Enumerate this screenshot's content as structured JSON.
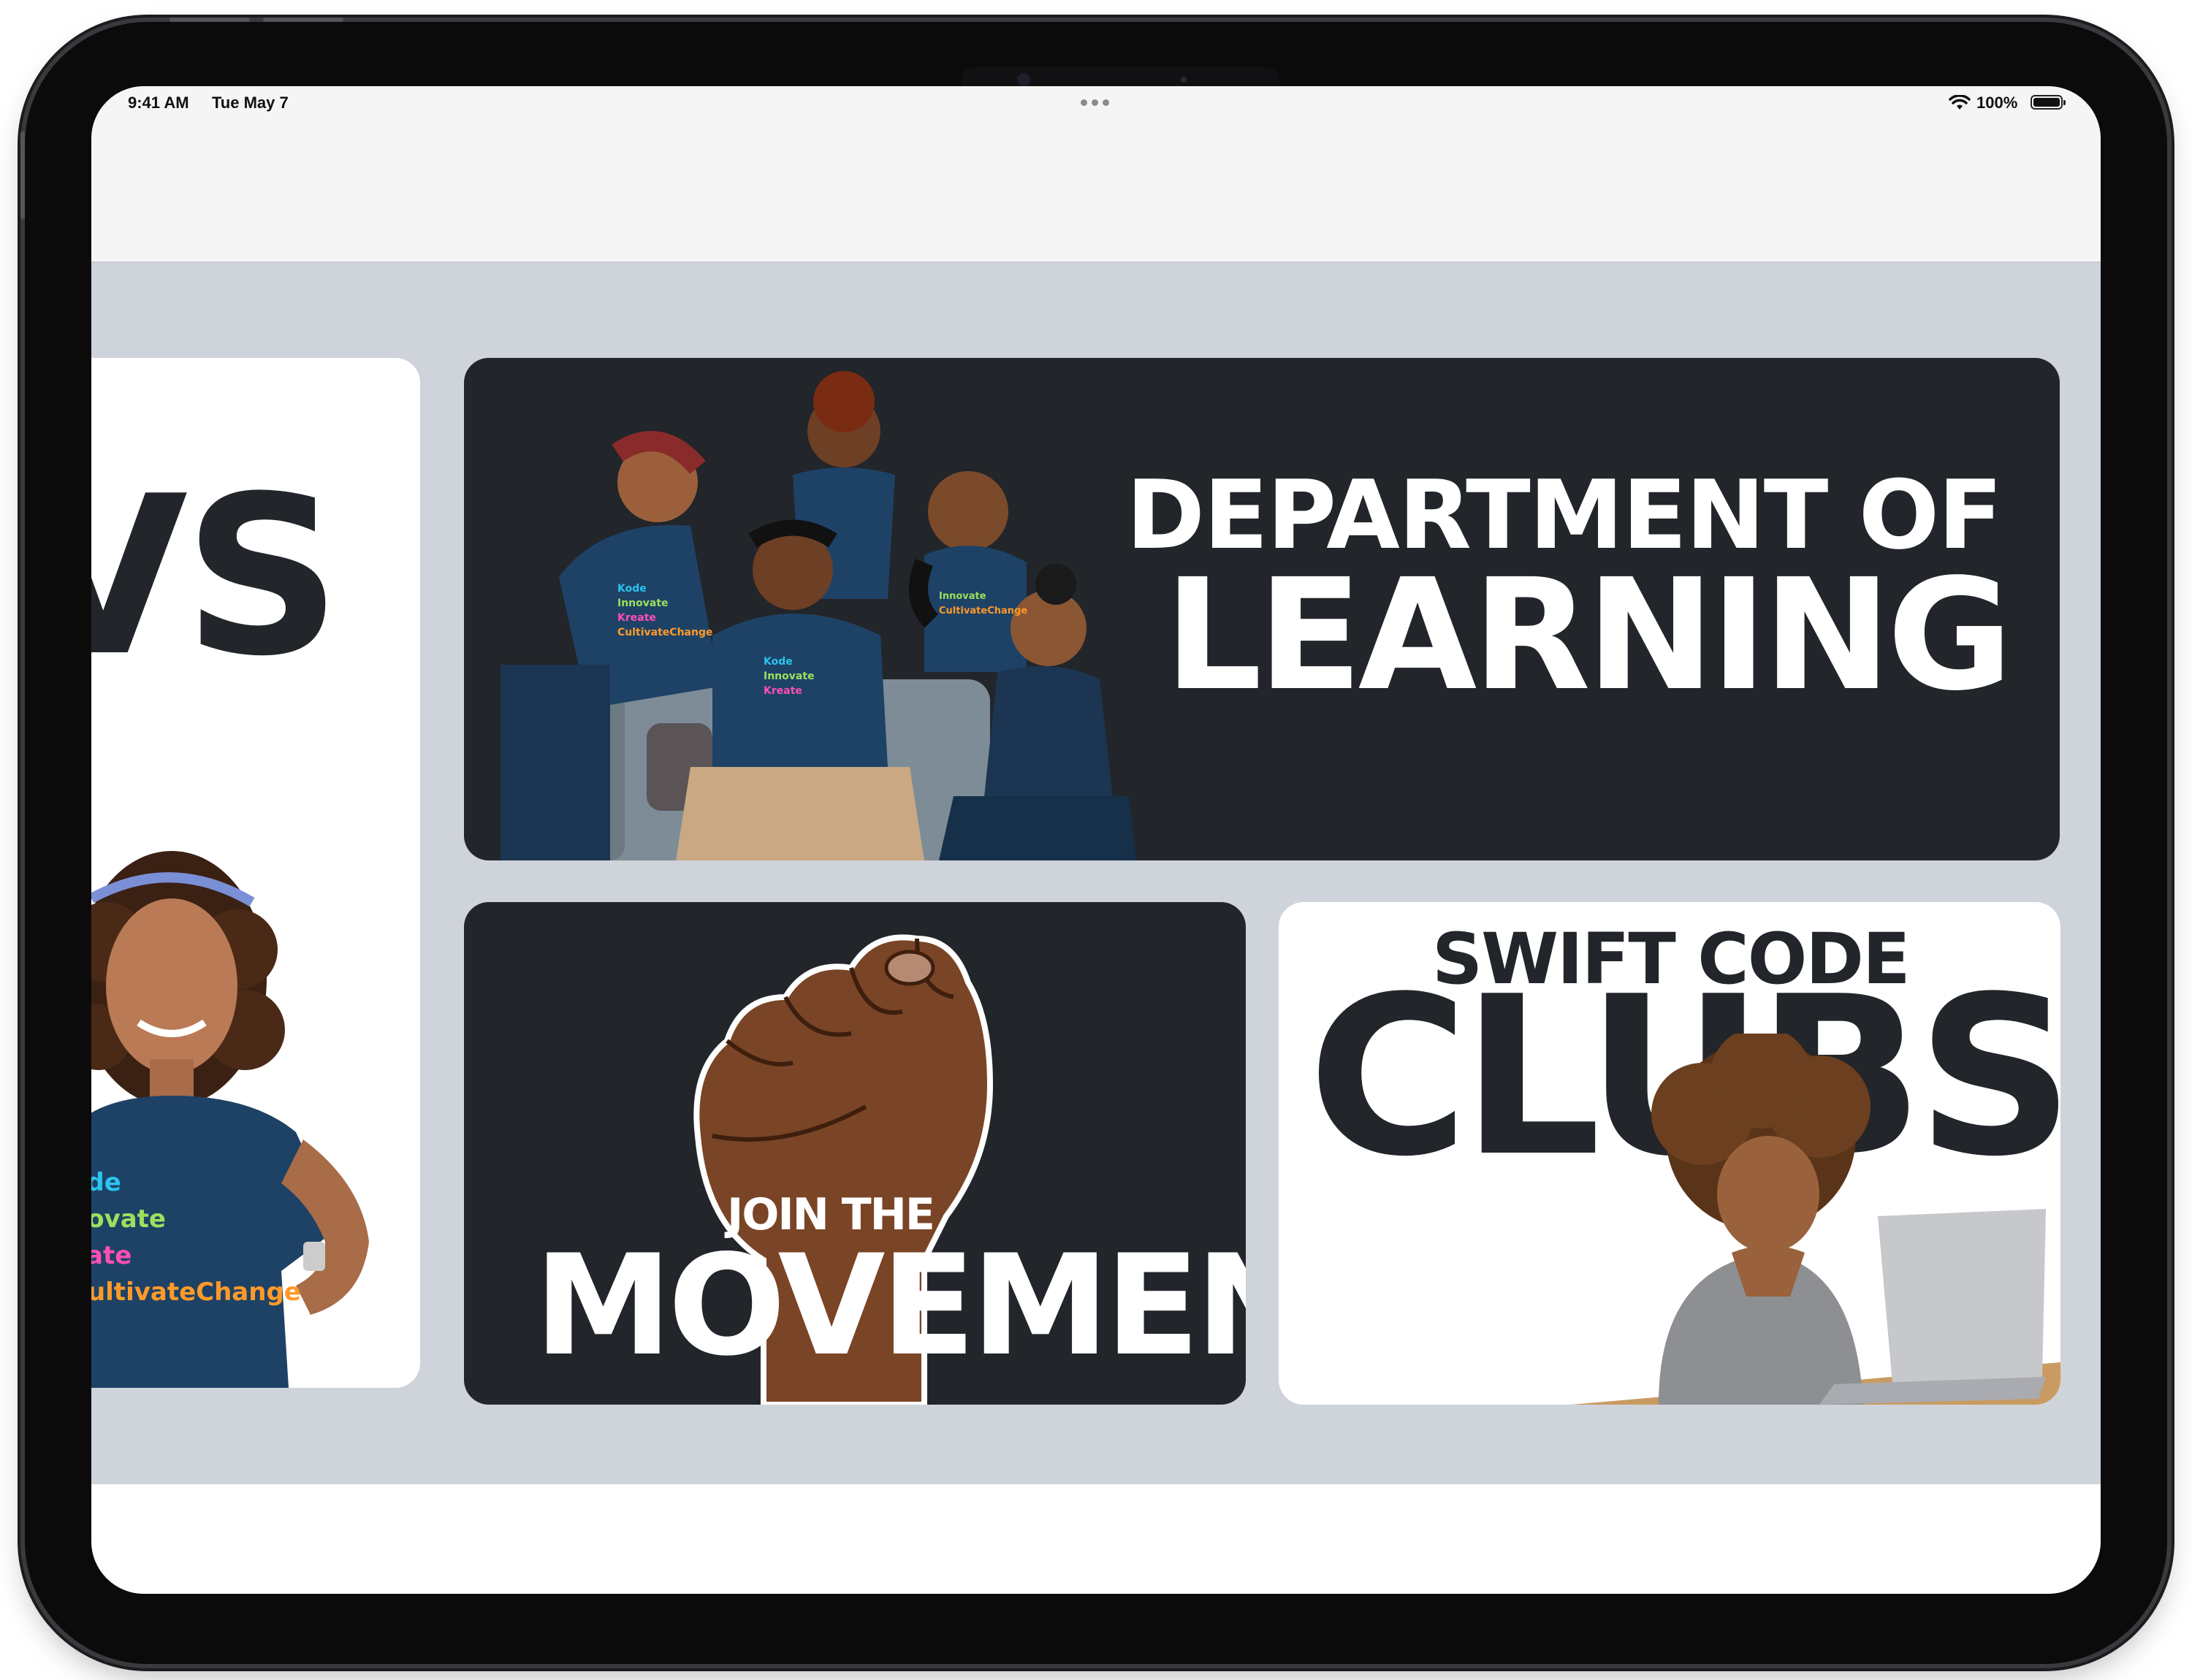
{
  "status_bar": {
    "time": "9:41 AM",
    "date": "Tue May 7",
    "battery_percent": "100%",
    "battery_level": 1.0,
    "icons": [
      "wifi-icon",
      "battery-icon",
      "more-dots-icon"
    ]
  },
  "cards": {
    "news": {
      "partial_title": "VS",
      "photo": "woman-portrait"
    },
    "department": {
      "line1": "DEPARTMENT OF",
      "line2": "LEARNING",
      "photo": "team-group-photo"
    },
    "movement": {
      "line1": "JOIN THE",
      "line2": "MOVEMENT",
      "graphic": "raised-fist-icon"
    },
    "swift": {
      "line1": "SWIFT CODE",
      "line2": "CLUBS",
      "photo": "child-with-laptop"
    }
  },
  "colors": {
    "card_dark": "#22252a",
    "card_light": "#ffffff",
    "content_background": "#cfd3da",
    "fist_skin": "#7a4526",
    "shirt_navy": "#1e4266"
  }
}
